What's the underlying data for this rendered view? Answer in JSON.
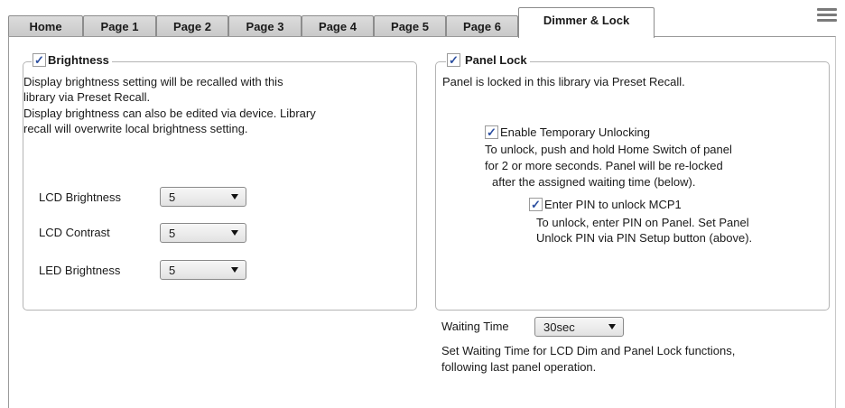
{
  "tabs": [
    {
      "label": "Home"
    },
    {
      "label": "Page 1"
    },
    {
      "label": "Page 2"
    },
    {
      "label": "Page 3"
    },
    {
      "label": "Page 4"
    },
    {
      "label": "Page 5"
    },
    {
      "label": "Page 6"
    },
    {
      "label": "Dimmer & Lock",
      "active": true
    }
  ],
  "brightness": {
    "title": "Brightness",
    "checked": true,
    "desc_lines": [
      "Display brightness setting will be recalled with this",
      "library via Preset Recall.",
      "Display brightness can also be edited via device. Library",
      "recall will overwrite local brightness setting."
    ],
    "controls": [
      {
        "label": "LCD Brightness",
        "value": "5"
      },
      {
        "label": "LCD Contrast",
        "value": "5"
      },
      {
        "label": "LED Brightness",
        "value": "5"
      }
    ]
  },
  "panel_lock": {
    "title": "Panel Lock",
    "checked": true,
    "desc": "Panel is locked in this library via Preset Recall.",
    "temp_unlock": {
      "label": "Enable Temporary Unlocking",
      "checked": true,
      "desc_lines": [
        "To unlock, push and hold Home Switch of panel",
        "for 2 or more seconds. Panel will be re-locked",
        "after the assigned waiting time (below)."
      ]
    },
    "pin": {
      "label": "Enter PIN to unlock MCP1",
      "checked": true,
      "desc_lines": [
        "To unlock, enter PIN on Panel. Set Panel",
        "Unlock PIN via PIN Setup button (above)."
      ]
    }
  },
  "waiting": {
    "label": "Waiting Time",
    "value": "30sec",
    "desc_lines": [
      "Set Waiting Time for LCD Dim and Panel Lock functions,",
      "following last panel operation."
    ]
  },
  "icons": {
    "menu": "hamburger-menu-icon",
    "check": "checkmark-icon"
  },
  "colors": {
    "check": "#2c4fa0",
    "tab_bg": "#d4d4d4",
    "border": "#b4b4b4"
  }
}
